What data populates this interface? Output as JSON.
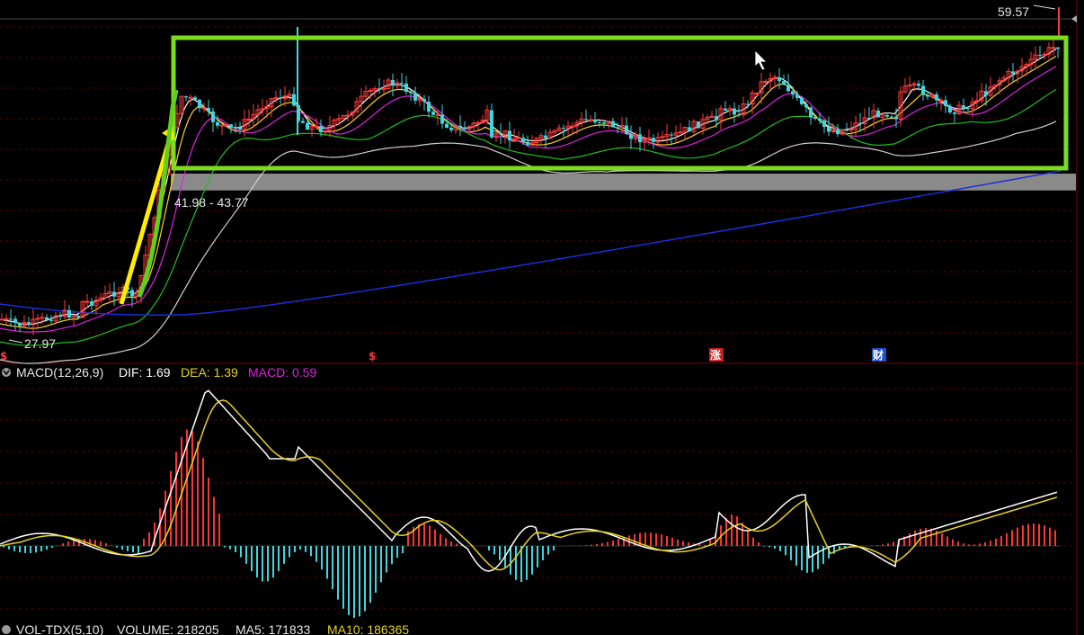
{
  "chart_data": [
    {
      "type": "candlestick",
      "price_high_label": "59.57",
      "price_low_label": "27.97",
      "zone_label": "41.98 - 43.77",
      "zone_range": [
        41.98,
        43.77
      ],
      "event_markers": [
        "$",
        "$",
        "涨",
        "财"
      ],
      "ma_lines": [
        {
          "color": "#ffffff"
        },
        {
          "color": "#ffd21f"
        },
        {
          "color": "#e020e0"
        },
        {
          "color": "#1fbf1f"
        },
        {
          "color": "#d0d0d0"
        },
        {
          "color": "#1a2fd8"
        }
      ],
      "colors": {
        "up": "#ff3b3b",
        "down": "#3fd6e0",
        "box": "#7cdc1e",
        "arrow_yellow": "#ffee00",
        "arrow_green": "#5fd11a",
        "zone": "#8a8a8a"
      }
    },
    {
      "type": "macd",
      "indicator_label": "MACD(12,26,9)",
      "dif_label": "DIF: 1.69",
      "dea_label": "DEA: 1.39",
      "macd_label": "MACD: 0.59",
      "dif": 1.69,
      "dea": 1.39,
      "macd": 0.59,
      "colors": {
        "dif": "#ffffff",
        "dea": "#e8d21e",
        "macd": "#e020e0",
        "hist_pos": "#ff3b3b",
        "hist_neg": "#3fd6e0"
      }
    },
    {
      "type": "volume",
      "indicator_label": "VOL-TDX(5,10)",
      "volume_label": "VOLUME: 218205",
      "ma5_label": "MA5: 171833",
      "ma10_label": "MA10: 186365",
      "volume": 218205,
      "ma5": 171833,
      "ma10": 186365
    }
  ]
}
